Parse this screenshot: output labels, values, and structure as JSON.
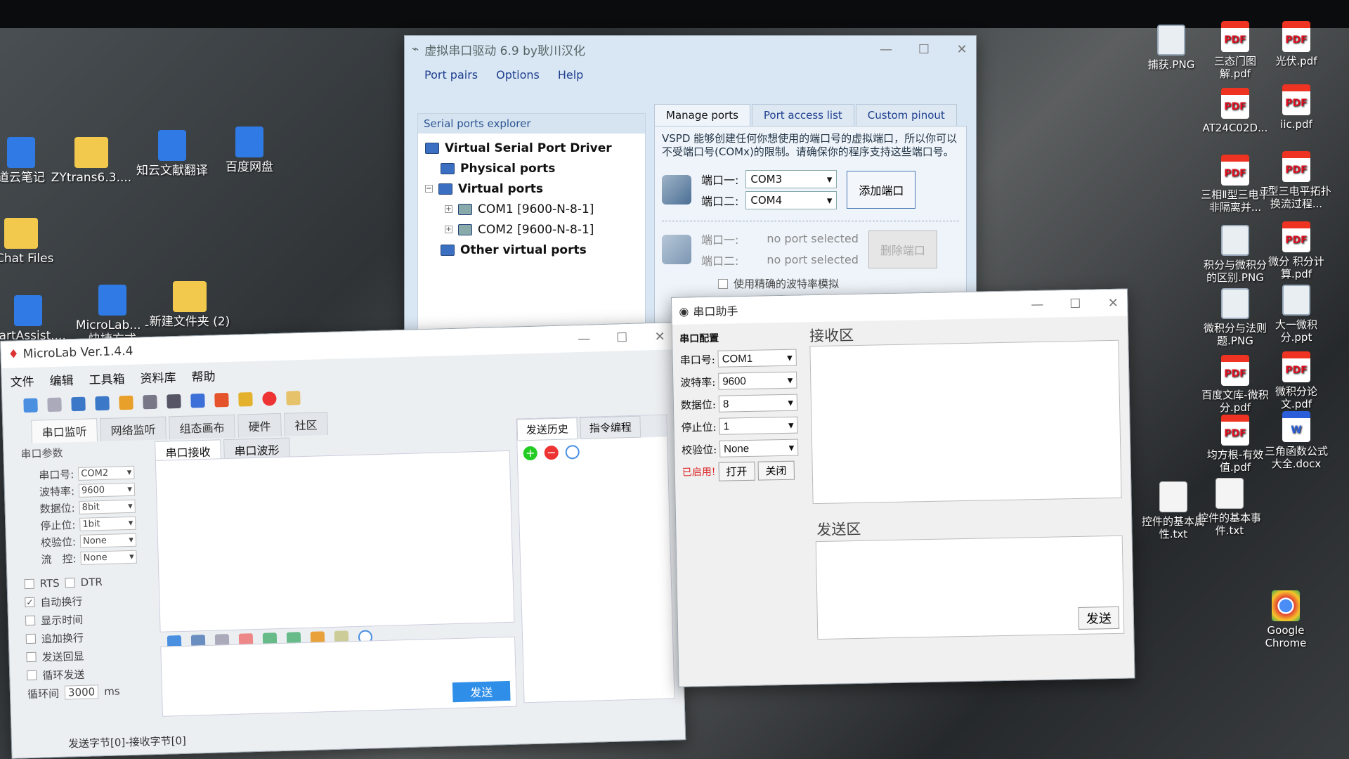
{
  "desktop": {
    "left_icons": [
      {
        "label": "道云笔记",
        "icon": "app-icon"
      },
      {
        "label": "ZYtrans6.3....",
        "icon": "folder-icon"
      },
      {
        "label": "知云文献翻译",
        "icon": "app-icon"
      },
      {
        "label": "百度网盘",
        "icon": "cloud-icon"
      },
      {
        "label": "eChat Files",
        "icon": "folder-icon"
      },
      {
        "label": "UartAssist....",
        "icon": "app-icon"
      },
      {
        "label": "MicroLab... - 快捷方式",
        "icon": "app-icon"
      },
      {
        "label": "新建文件夹 (2)",
        "icon": "folder-icon"
      }
    ],
    "right_icons": [
      {
        "label": "捕获.PNG",
        "type": "img"
      },
      {
        "label": "三态门图解.pdf",
        "type": "pdf"
      },
      {
        "label": "光伏.pdf",
        "type": "pdf"
      },
      {
        "label": "AT24C02D...",
        "type": "pdf"
      },
      {
        "label": "iic.pdf",
        "type": "pdf"
      },
      {
        "label": "三相Ⅱ型三电平非隔离并...",
        "type": "pdf"
      },
      {
        "label": "T型三电平拓扑换流过程...",
        "type": "pdf"
      },
      {
        "label": "积分与微积分的区别.PNG",
        "type": "img"
      },
      {
        "label": "微分 积分计算.pdf",
        "type": "pdf"
      },
      {
        "label": "微积分与法则题.PNG",
        "type": "img"
      },
      {
        "label": "大一微积分.ppt",
        "type": "ppt"
      },
      {
        "label": "百度文库-微积分.pdf",
        "type": "pdf"
      },
      {
        "label": "微积分论文.pdf",
        "type": "pdf"
      },
      {
        "label": "均方根-有效值.pdf",
        "type": "pdf"
      },
      {
        "label": "三角函数公式大全.docx",
        "type": "doc"
      },
      {
        "label": "控件的基本属性.txt",
        "type": "txt"
      },
      {
        "label": "控件的基本事件.txt",
        "type": "txt"
      },
      {
        "label": "Google Chrome",
        "type": "chrome"
      }
    ]
  },
  "vspd": {
    "title": "虚拟串口驱动 6.9 by耿川汉化",
    "menu": [
      "Port pairs",
      "Options",
      "Help"
    ],
    "explorer_header": "Serial ports explorer",
    "tree": {
      "root": "Virtual Serial Port Driver",
      "physical": "Physical ports",
      "virtual": "Virtual ports",
      "com1": "COM1 [9600-N-8-1]",
      "com2": "COM2 [9600-N-8-1]",
      "other": "Other virtual ports"
    },
    "tabs": [
      "Manage ports",
      "Port access list",
      "Custom pinout"
    ],
    "description": "VSPD 能够创建任何你想使用的端口号的虚拟端口，所以你可以不受端口号(COMx)的限制。请确保你的程序支持这些端口号。",
    "add": {
      "port1_label": "端口一:",
      "port1_value": "COM3",
      "port2_label": "端口二:",
      "port2_value": "COM4",
      "button": "添加端口"
    },
    "remove": {
      "port1_label": "端口一:",
      "port1_value": "no port selected",
      "port2_label": "端口二:",
      "port2_value": "no port selected",
      "button": "删除端口"
    },
    "baud_emulation": "使用精确的波特率模拟"
  },
  "microlab": {
    "title": "MicroLab Ver.1.4.4",
    "menu": [
      "文件",
      "编辑",
      "工具箱",
      "资料库",
      "帮助"
    ],
    "tabs": [
      "串口监听",
      "网络监听",
      "组态画布",
      "硬件",
      "社区"
    ],
    "params_header": "串口参数",
    "params": [
      {
        "label": "串口号:",
        "value": "COM2"
      },
      {
        "label": "波特率:",
        "value": "9600"
      },
      {
        "label": "数据位:",
        "value": "8bit"
      },
      {
        "label": "停止位:",
        "value": "1bit"
      },
      {
        "label": "校验位:",
        "value": "None"
      },
      {
        "label": "流　控:",
        "value": "None"
      }
    ],
    "rts": "RTS",
    "dtr": "DTR",
    "options": [
      {
        "label": "自动换行",
        "checked": "✓"
      },
      {
        "label": "显示时间",
        "checked": ""
      },
      {
        "label": "追加换行",
        "checked": ""
      },
      {
        "label": "发送回显",
        "checked": ""
      },
      {
        "label": "循环发送",
        "checked": ""
      }
    ],
    "loop_label": "循环间",
    "loop_value": "3000",
    "loop_unit": "ms",
    "subtabs": [
      "串口接收",
      "串口波形"
    ],
    "history_tabs": [
      "发送历史",
      "指令编程"
    ],
    "send_button": "发送",
    "status": "发送字节[0]-接收字节[0]"
  },
  "assistant": {
    "title": "串口助手",
    "config_header": "串口配置",
    "fields": [
      {
        "label": "串口号:",
        "value": "COM1"
      },
      {
        "label": "波特率:",
        "value": "9600"
      },
      {
        "label": "数据位:",
        "value": "8"
      },
      {
        "label": "停止位:",
        "value": "1"
      },
      {
        "label": "校验位:",
        "value": "None"
      }
    ],
    "status": "已启用!",
    "open": "打开",
    "close": "关闭",
    "recv_label": "接收区",
    "send_label": "发送区",
    "send_button": "发送"
  }
}
